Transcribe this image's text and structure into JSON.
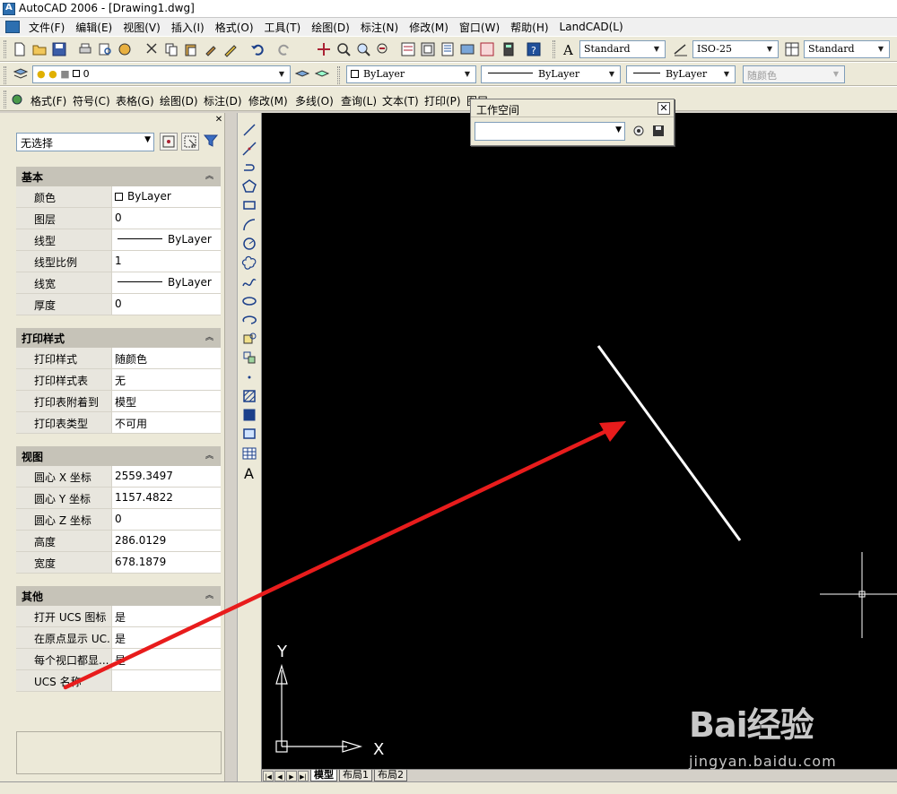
{
  "window": {
    "title": "AutoCAD 2006 - [Drawing1.dwg]"
  },
  "menu": [
    "文件(F)",
    "编辑(E)",
    "视图(V)",
    "插入(I)",
    "格式(O)",
    "工具(T)",
    "绘图(D)",
    "标注(N)",
    "修改(M)",
    "窗口(W)",
    "帮助(H)",
    "LandCAD(L)"
  ],
  "toolbar1": {
    "text_style": "Standard",
    "dim_style": "ISO-25",
    "table_style": "Standard"
  },
  "toolbar2": {
    "layer": "0",
    "color": "ByLayer",
    "linetype": "ByLayer",
    "lineweight": "ByLayer",
    "plotstyle": "随颜色"
  },
  "toolbar3": [
    "格式(F)",
    "符号(C)",
    "表格(G)",
    "绘图(D)",
    "标注(D)",
    "修改(M)",
    "多线(O)",
    "查询(L)",
    "文本(T)",
    "打印(P)",
    "图层"
  ],
  "workspace": {
    "title": "工作空间",
    "value": ""
  },
  "palette": {
    "selection": "无选择",
    "sections": [
      {
        "title": "基本",
        "rows": [
          {
            "key": "颜色",
            "value": "ByLayer",
            "kind": "color"
          },
          {
            "key": "图层",
            "value": "0",
            "kind": "text"
          },
          {
            "key": "线型",
            "value": "ByLayer",
            "kind": "line"
          },
          {
            "key": "线型比例",
            "value": "1",
            "kind": "text"
          },
          {
            "key": "线宽",
            "value": "ByLayer",
            "kind": "line"
          },
          {
            "key": "厚度",
            "value": "0",
            "kind": "text"
          }
        ]
      },
      {
        "title": "打印样式",
        "rows": [
          {
            "key": "打印样式",
            "value": "随颜色",
            "kind": "text"
          },
          {
            "key": "打印样式表",
            "value": "无",
            "kind": "text"
          },
          {
            "key": "打印表附着到",
            "value": "模型",
            "kind": "text"
          },
          {
            "key": "打印表类型",
            "value": "不可用",
            "kind": "text"
          }
        ]
      },
      {
        "title": "视图",
        "rows": [
          {
            "key": "圆心 X 坐标",
            "value": "2559.3497",
            "kind": "text"
          },
          {
            "key": "圆心 Y 坐标",
            "value": "1157.4822",
            "kind": "text"
          },
          {
            "key": "圆心 Z 坐标",
            "value": "0",
            "kind": "text"
          },
          {
            "key": "高度",
            "value": "286.0129",
            "kind": "text"
          },
          {
            "key": "宽度",
            "value": "678.1879",
            "kind": "text"
          }
        ]
      },
      {
        "title": "其他",
        "rows": [
          {
            "key": "打开 UCS 图标",
            "value": "是",
            "kind": "text"
          },
          {
            "key": "在原点显示 UC...",
            "value": "是",
            "kind": "text"
          },
          {
            "key": "每个视口都显...",
            "value": "是",
            "kind": "text"
          },
          {
            "key": "UCS 名称",
            "value": "",
            "kind": "text"
          }
        ]
      }
    ]
  },
  "ucs": {
    "x_label": "X",
    "y_label": "Y"
  },
  "layout_tabs": [
    "模型",
    "布局1",
    "布局2"
  ],
  "watermark": {
    "brand": "Bai经验",
    "url": "jingyan.baidu.com"
  },
  "colors": {
    "canvas": "#000000",
    "annotation_arrow": "#e81c1c",
    "drawn_line": "#ffffff"
  }
}
